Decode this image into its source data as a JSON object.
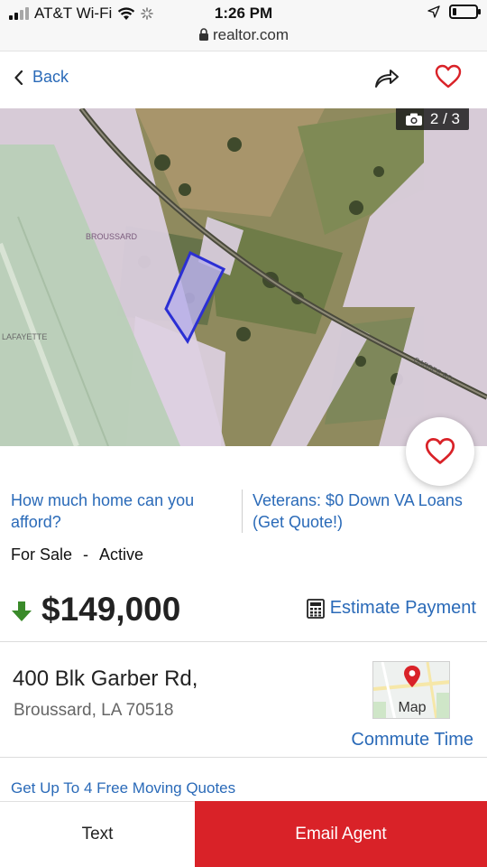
{
  "status_bar": {
    "carrier": "AT&T Wi-Fi",
    "time": "1:26 PM",
    "url": "realtor.com",
    "battery_level": 0.15
  },
  "nav": {
    "back_label": "Back",
    "icons": [
      "chevron-left-icon",
      "share-icon",
      "heart-icon"
    ]
  },
  "photo": {
    "counter": "2 / 3",
    "map_labels": [
      "BROUSSARD",
      "LAFAYETTE",
      "GARBER RD"
    ]
  },
  "promo": {
    "left_link": "How much home can you afford?",
    "right_link": "Veterans: $0 Down VA Loans (Get Quote!)"
  },
  "listing": {
    "for_sale": "For Sale",
    "separator": "-",
    "active": "Active",
    "price": "$149,000",
    "estimate_payment": "Estimate Payment",
    "address_line1": "400 Blk Garber Rd,",
    "address_line2": "Broussard, LA 70518",
    "map_label": "Map",
    "commute_time": "Commute Time",
    "moving_quotes": "Get Up To 4 Free Moving Quotes"
  },
  "actions": {
    "text_label": "Text",
    "email_label": "Email Agent"
  },
  "colors": {
    "accent_blue": "#2a6ab8",
    "brand_red": "#d92228",
    "price_down_green": "#3a8a2a"
  }
}
